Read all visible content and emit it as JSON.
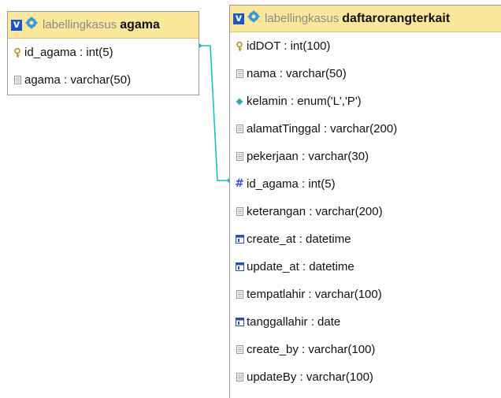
{
  "tables": [
    {
      "id": "agama",
      "v_label": "v",
      "database": "labellingkasus",
      "name": "agama",
      "columns": [
        {
          "text": "id_agama : int(5)",
          "icon": "primary-key-icon"
        },
        {
          "text": "agama : varchar(50)",
          "icon": "text-column-icon"
        }
      ]
    },
    {
      "id": "daftarorangterkait",
      "v_label": "v",
      "database": "labellingkasus",
      "name": "daftarorangterkait",
      "columns": [
        {
          "text": "idDOT : int(100)",
          "icon": "primary-key-icon"
        },
        {
          "text": "nama : varchar(50)",
          "icon": "text-column-icon"
        },
        {
          "text": "kelamin : enum('L','P')",
          "icon": "enum-column-icon"
        },
        {
          "text": "alamatTinggal : varchar(200)",
          "icon": "text-column-icon"
        },
        {
          "text": "pekerjaan : varchar(30)",
          "icon": "text-column-icon"
        },
        {
          "text": "id_agama : int(5)",
          "icon": "numeric-column-icon"
        },
        {
          "text": "keterangan : varchar(200)",
          "icon": "text-column-icon"
        },
        {
          "text": "create_at : datetime",
          "icon": "date-column-icon"
        },
        {
          "text": "update_at : datetime",
          "icon": "date-column-icon"
        },
        {
          "text": "tempatlahir : varchar(100)",
          "icon": "text-column-icon"
        },
        {
          "text": "tanggallahir : date",
          "icon": "date-column-icon"
        },
        {
          "text": "create_by : varchar(100)",
          "icon": "text-column-icon"
        },
        {
          "text": "updateBy : varchar(100)",
          "icon": "text-column-icon"
        }
      ]
    }
  ],
  "colors": {
    "header_bg": "#fce89a",
    "relation_line": "#18c1c1",
    "v_button": "#1a56c9",
    "gear": "#3a98d8"
  }
}
